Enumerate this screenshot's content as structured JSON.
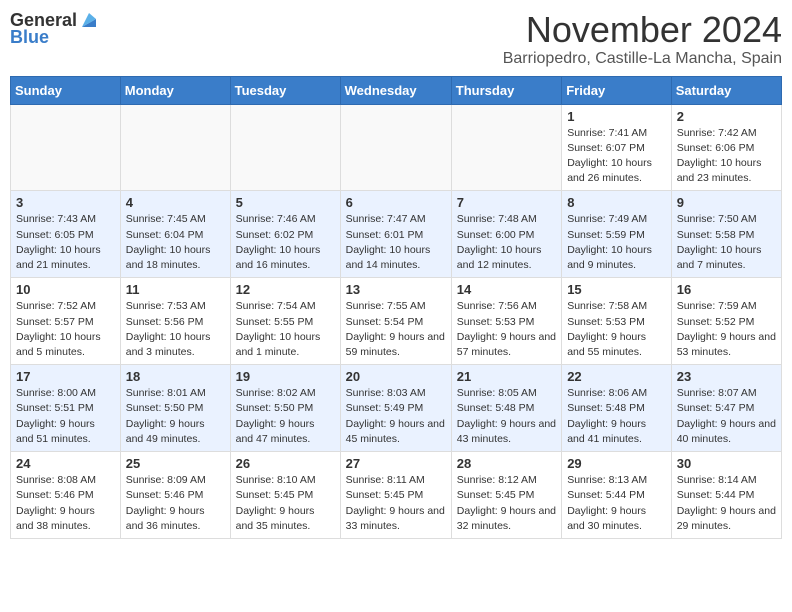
{
  "header": {
    "logo_general": "General",
    "logo_blue": "Blue",
    "month": "November 2024",
    "location": "Barriopedro, Castille-La Mancha, Spain"
  },
  "weekdays": [
    "Sunday",
    "Monday",
    "Tuesday",
    "Wednesday",
    "Thursday",
    "Friday",
    "Saturday"
  ],
  "weeks": [
    [
      {
        "day": "",
        "info": ""
      },
      {
        "day": "",
        "info": ""
      },
      {
        "day": "",
        "info": ""
      },
      {
        "day": "",
        "info": ""
      },
      {
        "day": "",
        "info": ""
      },
      {
        "day": "1",
        "info": "Sunrise: 7:41 AM\nSunset: 6:07 PM\nDaylight: 10 hours and 26 minutes."
      },
      {
        "day": "2",
        "info": "Sunrise: 7:42 AM\nSunset: 6:06 PM\nDaylight: 10 hours and 23 minutes."
      }
    ],
    [
      {
        "day": "3",
        "info": "Sunrise: 7:43 AM\nSunset: 6:05 PM\nDaylight: 10 hours and 21 minutes."
      },
      {
        "day": "4",
        "info": "Sunrise: 7:45 AM\nSunset: 6:04 PM\nDaylight: 10 hours and 18 minutes."
      },
      {
        "day": "5",
        "info": "Sunrise: 7:46 AM\nSunset: 6:02 PM\nDaylight: 10 hours and 16 minutes."
      },
      {
        "day": "6",
        "info": "Sunrise: 7:47 AM\nSunset: 6:01 PM\nDaylight: 10 hours and 14 minutes."
      },
      {
        "day": "7",
        "info": "Sunrise: 7:48 AM\nSunset: 6:00 PM\nDaylight: 10 hours and 12 minutes."
      },
      {
        "day": "8",
        "info": "Sunrise: 7:49 AM\nSunset: 5:59 PM\nDaylight: 10 hours and 9 minutes."
      },
      {
        "day": "9",
        "info": "Sunrise: 7:50 AM\nSunset: 5:58 PM\nDaylight: 10 hours and 7 minutes."
      }
    ],
    [
      {
        "day": "10",
        "info": "Sunrise: 7:52 AM\nSunset: 5:57 PM\nDaylight: 10 hours and 5 minutes."
      },
      {
        "day": "11",
        "info": "Sunrise: 7:53 AM\nSunset: 5:56 PM\nDaylight: 10 hours and 3 minutes."
      },
      {
        "day": "12",
        "info": "Sunrise: 7:54 AM\nSunset: 5:55 PM\nDaylight: 10 hours and 1 minute."
      },
      {
        "day": "13",
        "info": "Sunrise: 7:55 AM\nSunset: 5:54 PM\nDaylight: 9 hours and 59 minutes."
      },
      {
        "day": "14",
        "info": "Sunrise: 7:56 AM\nSunset: 5:53 PM\nDaylight: 9 hours and 57 minutes."
      },
      {
        "day": "15",
        "info": "Sunrise: 7:58 AM\nSunset: 5:53 PM\nDaylight: 9 hours and 55 minutes."
      },
      {
        "day": "16",
        "info": "Sunrise: 7:59 AM\nSunset: 5:52 PM\nDaylight: 9 hours and 53 minutes."
      }
    ],
    [
      {
        "day": "17",
        "info": "Sunrise: 8:00 AM\nSunset: 5:51 PM\nDaylight: 9 hours and 51 minutes."
      },
      {
        "day": "18",
        "info": "Sunrise: 8:01 AM\nSunset: 5:50 PM\nDaylight: 9 hours and 49 minutes."
      },
      {
        "day": "19",
        "info": "Sunrise: 8:02 AM\nSunset: 5:50 PM\nDaylight: 9 hours and 47 minutes."
      },
      {
        "day": "20",
        "info": "Sunrise: 8:03 AM\nSunset: 5:49 PM\nDaylight: 9 hours and 45 minutes."
      },
      {
        "day": "21",
        "info": "Sunrise: 8:05 AM\nSunset: 5:48 PM\nDaylight: 9 hours and 43 minutes."
      },
      {
        "day": "22",
        "info": "Sunrise: 8:06 AM\nSunset: 5:48 PM\nDaylight: 9 hours and 41 minutes."
      },
      {
        "day": "23",
        "info": "Sunrise: 8:07 AM\nSunset: 5:47 PM\nDaylight: 9 hours and 40 minutes."
      }
    ],
    [
      {
        "day": "24",
        "info": "Sunrise: 8:08 AM\nSunset: 5:46 PM\nDaylight: 9 hours and 38 minutes."
      },
      {
        "day": "25",
        "info": "Sunrise: 8:09 AM\nSunset: 5:46 PM\nDaylight: 9 hours and 36 minutes."
      },
      {
        "day": "26",
        "info": "Sunrise: 8:10 AM\nSunset: 5:45 PM\nDaylight: 9 hours and 35 minutes."
      },
      {
        "day": "27",
        "info": "Sunrise: 8:11 AM\nSunset: 5:45 PM\nDaylight: 9 hours and 33 minutes."
      },
      {
        "day": "28",
        "info": "Sunrise: 8:12 AM\nSunset: 5:45 PM\nDaylight: 9 hours and 32 minutes."
      },
      {
        "day": "29",
        "info": "Sunrise: 8:13 AM\nSunset: 5:44 PM\nDaylight: 9 hours and 30 minutes."
      },
      {
        "day": "30",
        "info": "Sunrise: 8:14 AM\nSunset: 5:44 PM\nDaylight: 9 hours and 29 minutes."
      }
    ]
  ]
}
